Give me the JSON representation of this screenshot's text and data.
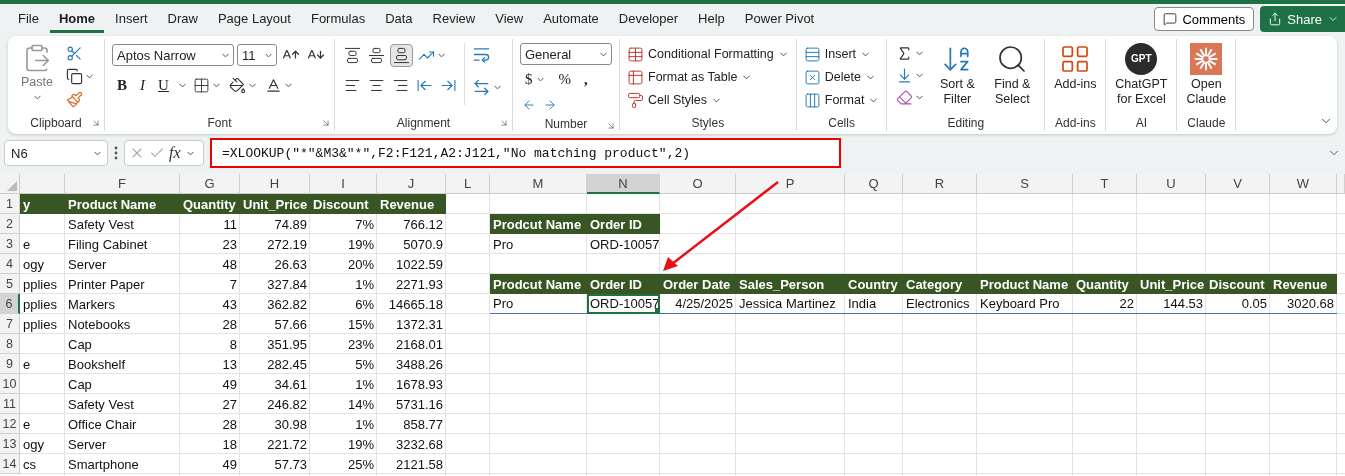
{
  "tabs": [
    {
      "label": "File",
      "selected": false
    },
    {
      "label": "Home",
      "selected": true
    },
    {
      "label": "Insert",
      "selected": false
    },
    {
      "label": "Draw",
      "selected": false
    },
    {
      "label": "Page Layout",
      "selected": false
    },
    {
      "label": "Formulas",
      "selected": false
    },
    {
      "label": "Data",
      "selected": false
    },
    {
      "label": "Review",
      "selected": false
    },
    {
      "label": "View",
      "selected": false
    },
    {
      "label": "Automate",
      "selected": false
    },
    {
      "label": "Developer",
      "selected": false
    },
    {
      "label": "Help",
      "selected": false
    },
    {
      "label": "Power Pivot",
      "selected": false
    }
  ],
  "header_buttons": {
    "comments": "Comments",
    "share": "Share"
  },
  "ribbon": {
    "groups": [
      {
        "kind": "clipboard",
        "title": "Clipboard",
        "paste": "Paste"
      },
      {
        "kind": "font",
        "title": "Font",
        "font_name": "Aptos Narrow",
        "font_size": "11",
        "style_buttons": [
          "B",
          "I",
          "U"
        ]
      },
      {
        "kind": "alignment",
        "title": "Alignment"
      },
      {
        "kind": "number",
        "title": "Number",
        "format": "General",
        "symbols": [
          "$",
          "%",
          ","
        ]
      },
      {
        "kind": "styles",
        "title": "Styles",
        "commands": [
          "Conditional Formatting",
          "Format as Table",
          "Cell Styles"
        ]
      },
      {
        "kind": "cells",
        "title": "Cells",
        "commands": [
          "Insert",
          "Delete",
          "Format"
        ]
      },
      {
        "kind": "editing",
        "title": "Editing",
        "commands": [
          "Sort & Filter",
          "Find & Select"
        ]
      },
      {
        "kind": "addins",
        "title": "Add-ins",
        "commands": [
          "Add-ins"
        ]
      },
      {
        "kind": "ai",
        "title": "AI",
        "logo_text": "GPT",
        "commands": [
          "ChatGPT for Excel"
        ]
      },
      {
        "kind": "claude",
        "title": "Claude",
        "commands": [
          "Open Claude"
        ]
      }
    ]
  },
  "formula_bar": {
    "name_box": "N6",
    "function_symbol": "fx",
    "formula": "=XLOOKUP(\"*\"&M3&\"*\",F2:F121,A2:J121,\"No matching product\",2)"
  },
  "sheet": {
    "columns": [
      {
        "selected": false
      },
      {
        "label": "F",
        "selected": false
      },
      {
        "label": "G",
        "selected": false
      },
      {
        "label": "H",
        "selected": false
      },
      {
        "label": "I",
        "selected": false
      },
      {
        "label": "J",
        "selected": false
      },
      {
        "label": "L",
        "selected": false
      },
      {
        "label": "M",
        "selected": false
      },
      {
        "label": "N",
        "selected": true
      },
      {
        "label": "O",
        "selected": false
      },
      {
        "label": "P",
        "selected": false
      },
      {
        "label": "Q",
        "selected": false
      },
      {
        "label": "R",
        "selected": false
      },
      {
        "label": "S",
        "selected": false
      },
      {
        "label": "T",
        "selected": false
      },
      {
        "label": "U",
        "selected": false
      },
      {
        "label": "V",
        "selected": false
      },
      {
        "label": "W",
        "selected": false
      }
    ],
    "rows": [
      {
        "number": "1",
        "selected": false,
        "cells": [
          {
            "text": "y",
            "kind": "header"
          },
          {
            "text": "Product Name",
            "kind": "header"
          },
          {
            "text": "Quantity",
            "kind": "header"
          },
          {
            "text": "Unit_Price",
            "kind": "header"
          },
          {
            "text": "Discount",
            "kind": "header"
          },
          {
            "text": "Revenue",
            "kind": "header"
          }
        ]
      },
      {
        "number": "2",
        "selected": false,
        "cells": [
          null,
          {
            "text": "Safety Vest",
            "kind": "value"
          },
          {
            "text": "11",
            "kind": "value"
          },
          {
            "text": "74.89",
            "kind": "value"
          },
          {
            "text": "7%",
            "kind": "value"
          },
          {
            "text": "766.12",
            "kind": "value"
          },
          null,
          {
            "text": "Prodcut Name",
            "kind": "header"
          },
          {
            "text": "Order ID",
            "kind": "header"
          }
        ]
      },
      {
        "number": "3",
        "selected": false,
        "cells": [
          {
            "text": "e",
            "kind": "value"
          },
          {
            "text": "Filing Cabinet",
            "kind": "value"
          },
          {
            "text": "23",
            "kind": "value"
          },
          {
            "text": "272.19",
            "kind": "value"
          },
          {
            "text": "19%",
            "kind": "value"
          },
          {
            "text": "5070.9",
            "kind": "value"
          },
          null,
          {
            "text": "Pro",
            "kind": "value"
          },
          {
            "text": "ORD-10057",
            "kind": "value"
          }
        ]
      },
      {
        "number": "4",
        "selected": false,
        "cells": [
          {
            "text": "ogy",
            "kind": "value"
          },
          {
            "text": "Server",
            "kind": "value"
          },
          {
            "text": "48",
            "kind": "value"
          },
          {
            "text": "26.63",
            "kind": "value"
          },
          {
            "text": "20%",
            "kind": "value"
          },
          {
            "text": "1022.59",
            "kind": "value"
          }
        ]
      },
      {
        "number": "5",
        "selected": false,
        "cells": [
          {
            "text": "pplies",
            "kind": "value"
          },
          {
            "text": "Printer Paper",
            "kind": "value"
          },
          {
            "text": "7",
            "kind": "value"
          },
          {
            "text": "327.84",
            "kind": "value"
          },
          {
            "text": "1%",
            "kind": "value"
          },
          {
            "text": "2271.93",
            "kind": "value"
          },
          null,
          {
            "text": "Prodcut Name",
            "kind": "header"
          },
          {
            "text": "Order ID",
            "kind": "header"
          },
          {
            "text": "Order Date",
            "kind": "header"
          },
          {
            "text": "Sales_Person",
            "kind": "header"
          },
          {
            "text": "Country",
            "kind": "header"
          },
          {
            "text": "Category",
            "kind": "header"
          },
          {
            "text": "Product Name",
            "kind": "header"
          },
          {
            "text": "Quantity",
            "kind": "header"
          },
          {
            "text": "Unit_Price",
            "kind": "header"
          },
          {
            "text": "Discount",
            "kind": "header"
          },
          {
            "text": "Revenue",
            "kind": "header"
          }
        ]
      },
      {
        "number": "6",
        "selected": true,
        "cells": [
          {
            "text": "pplies",
            "kind": "value"
          },
          {
            "text": "Markers",
            "kind": "value"
          },
          {
            "text": "43",
            "kind": "value"
          },
          {
            "text": "362.82",
            "kind": "value"
          },
          {
            "text": "6%",
            "kind": "value"
          },
          {
            "text": "14665.18",
            "kind": "value"
          },
          null,
          {
            "text": "Pro",
            "kind": "spill"
          },
          {
            "text": "ORD-10057",
            "kind": "spill"
          },
          {
            "text": "4/25/2025",
            "kind": "spill"
          },
          {
            "text": "Jessica Martinez",
            "kind": "spill"
          },
          {
            "text": "India",
            "kind": "spill"
          },
          {
            "text": "Electronics",
            "kind": "spill"
          },
          {
            "text": "Keyboard Pro",
            "kind": "spill"
          },
          {
            "text": "22",
            "kind": "spill"
          },
          {
            "text": "144.53",
            "kind": "spill"
          },
          {
            "text": "0.05",
            "kind": "spill"
          },
          {
            "text": "3020.68",
            "kind": "spill"
          }
        ]
      },
      {
        "number": "7",
        "selected": false,
        "cells": [
          {
            "text": "pplies",
            "kind": "value"
          },
          {
            "text": "Notebooks",
            "kind": "value"
          },
          {
            "text": "28",
            "kind": "value"
          },
          {
            "text": "57.66",
            "kind": "value"
          },
          {
            "text": "15%",
            "kind": "value"
          },
          {
            "text": "1372.31",
            "kind": "value"
          }
        ]
      },
      {
        "number": "8",
        "selected": false,
        "cells": [
          null,
          {
            "text": "Cap",
            "kind": "value"
          },
          {
            "text": "8",
            "kind": "value"
          },
          {
            "text": "351.95",
            "kind": "value"
          },
          {
            "text": "23%",
            "kind": "value"
          },
          {
            "text": "2168.01",
            "kind": "value"
          }
        ]
      },
      {
        "number": "9",
        "selected": false,
        "cells": [
          {
            "text": "e",
            "kind": "value"
          },
          {
            "text": "Bookshelf",
            "kind": "value"
          },
          {
            "text": "13",
            "kind": "value"
          },
          {
            "text": "282.45",
            "kind": "value"
          },
          {
            "text": "5%",
            "kind": "value"
          },
          {
            "text": "3488.26",
            "kind": "value"
          }
        ]
      },
      {
        "number": "10",
        "selected": false,
        "cells": [
          null,
          {
            "text": "Cap",
            "kind": "value"
          },
          {
            "text": "49",
            "kind": "value"
          },
          {
            "text": "34.61",
            "kind": "value"
          },
          {
            "text": "1%",
            "kind": "value"
          },
          {
            "text": "1678.93",
            "kind": "value"
          }
        ]
      },
      {
        "number": "11",
        "selected": false,
        "cells": [
          null,
          {
            "text": "Safety Vest",
            "kind": "value"
          },
          {
            "text": "27",
            "kind": "value"
          },
          {
            "text": "246.82",
            "kind": "value"
          },
          {
            "text": "14%",
            "kind": "value"
          },
          {
            "text": "5731.16",
            "kind": "value"
          }
        ]
      },
      {
        "number": "12",
        "selected": false,
        "cells": [
          {
            "text": "e",
            "kind": "value"
          },
          {
            "text": "Office Chair",
            "kind": "value"
          },
          {
            "text": "28",
            "kind": "value"
          },
          {
            "text": "30.98",
            "kind": "value"
          },
          {
            "text": "1%",
            "kind": "value"
          },
          {
            "text": "858.77",
            "kind": "value"
          }
        ]
      },
      {
        "number": "13",
        "selected": false,
        "cells": [
          {
            "text": "ogy",
            "kind": "value"
          },
          {
            "text": "Server",
            "kind": "value"
          },
          {
            "text": "18",
            "kind": "value"
          },
          {
            "text": "221.72",
            "kind": "value"
          },
          {
            "text": "19%",
            "kind": "value"
          },
          {
            "text": "3232.68",
            "kind": "value"
          }
        ]
      },
      {
        "number": "14",
        "selected": false,
        "cells": [
          {
            "text": "cs",
            "kind": "value"
          },
          {
            "text": "Smartphone",
            "kind": "value"
          },
          {
            "text": "49",
            "kind": "value"
          },
          {
            "text": "57.73",
            "kind": "value"
          },
          {
            "text": "25%",
            "kind": "value"
          },
          {
            "text": "2121.58",
            "kind": "value"
          }
        ]
      }
    ]
  }
}
